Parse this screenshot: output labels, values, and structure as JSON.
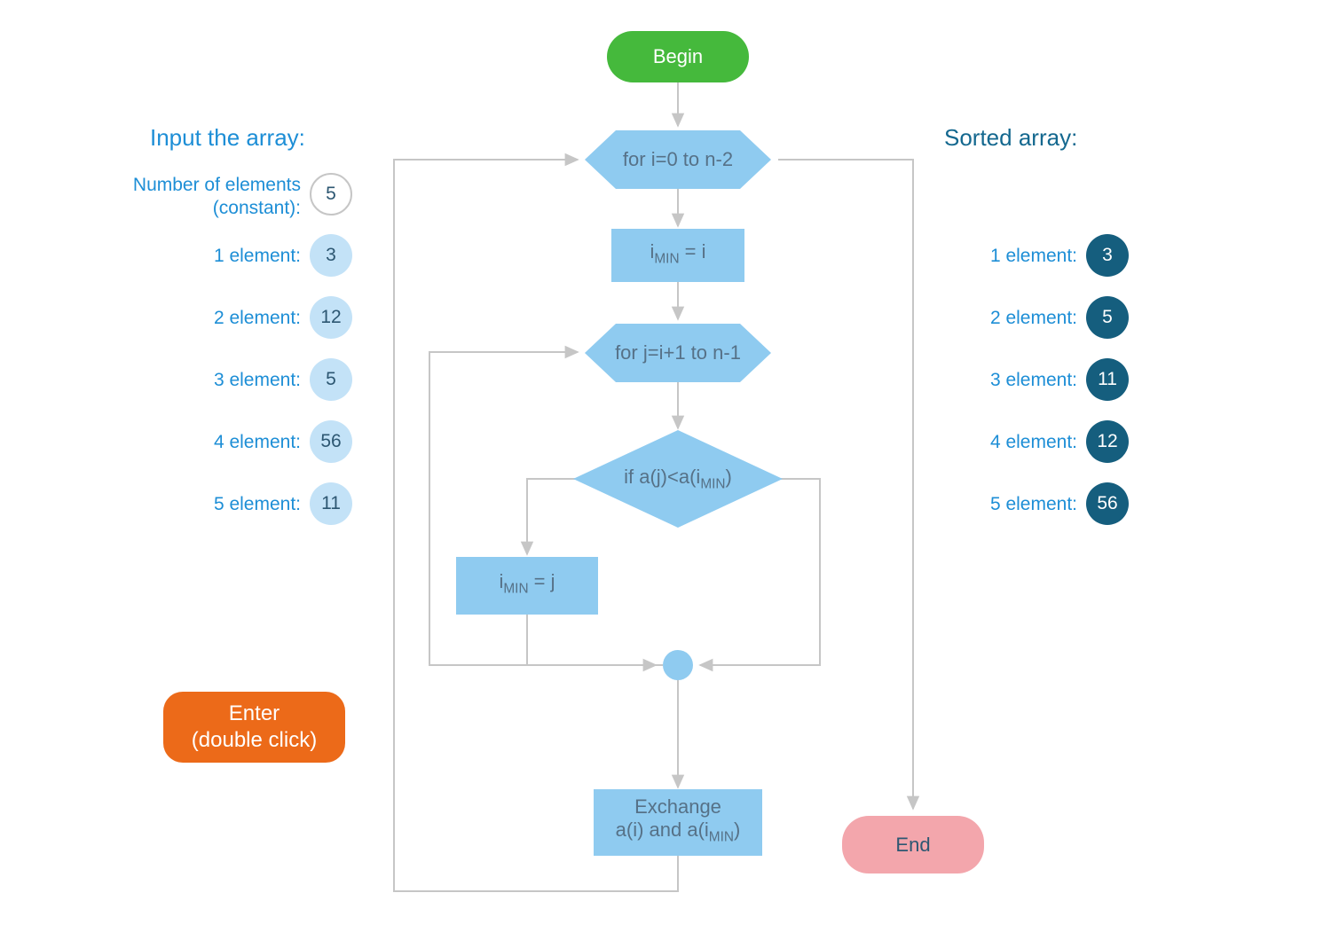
{
  "input": {
    "title": "Input the array:",
    "num_label": "Number of elements (constant):",
    "num_value": "5",
    "rows": [
      {
        "label": "1 element:",
        "value": "3"
      },
      {
        "label": "2 element:",
        "value": "12"
      },
      {
        "label": "3 element:",
        "value": "5"
      },
      {
        "label": "4 element:",
        "value": "56"
      },
      {
        "label": "5 element:",
        "value": "11"
      }
    ]
  },
  "enter_button": "Enter\n(double click)",
  "sorted": {
    "title": "Sorted array:",
    "rows": [
      {
        "label": "1 element:",
        "value": "3"
      },
      {
        "label": "2 element:",
        "value": "5"
      },
      {
        "label": "3 element:",
        "value": "11"
      },
      {
        "label": "4 element:",
        "value": "12"
      },
      {
        "label": "5 element:",
        "value": "56"
      }
    ]
  },
  "flow": {
    "begin": "Begin",
    "for_i": "for i=0 to n-2",
    "imin_eq_i_pre": "i",
    "imin_eq_i_sub": "MIN",
    "imin_eq_i_post": " = i",
    "for_j": "for j=i+1 to n-1",
    "cond_pre": "if a(j)<a(i",
    "cond_sub": "MIN",
    "cond_post": ")",
    "imin_eq_j_pre": "i",
    "imin_eq_j_sub": "MIN",
    "imin_eq_j_post": " = j",
    "exchange_line1": "Exchange",
    "exchange_pre": "a(i) and a(i",
    "exchange_sub": "MIN",
    "exchange_post": ")",
    "end": "End"
  }
}
